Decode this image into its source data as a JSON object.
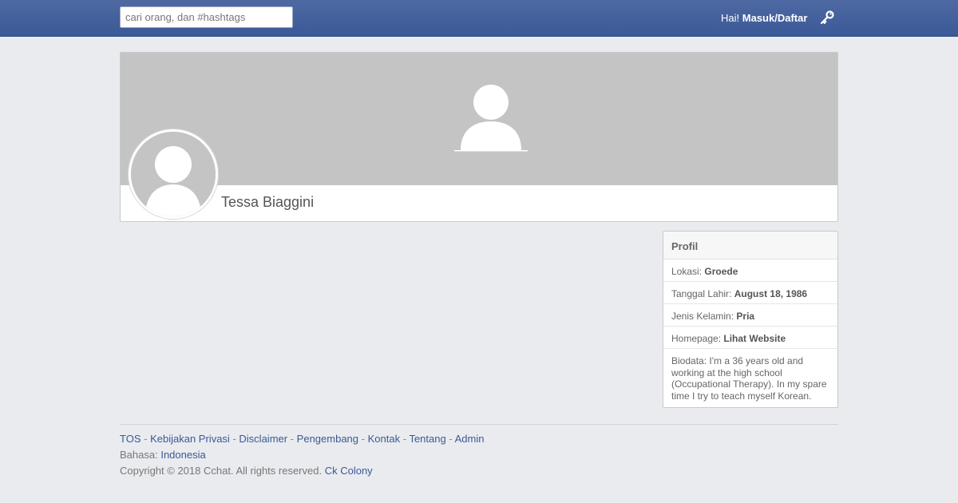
{
  "header": {
    "search_placeholder": "cari orang, dan #hashtags",
    "greeting": "Hai!",
    "login_label": "Masuk/Daftar"
  },
  "profile": {
    "name": "Tessa Biaggini"
  },
  "panel": {
    "title": "Profil",
    "location_label": "Lokasi:",
    "location_value": "Groede",
    "birth_label": "Tanggal Lahir:",
    "birth_value": "August 18, 1986",
    "gender_label": "Jenis Kelamin:",
    "gender_value": "Pria",
    "homepage_label": "Homepage:",
    "homepage_value": "Lihat Website",
    "bio_label": "Biodata:",
    "bio_value": "I'm a 36 years old and working at the high school (Occupational Therapy). In my spare time I try to teach myself Korean."
  },
  "footer": {
    "links": [
      "TOS",
      "Kebijakan Privasi",
      "Disclaimer",
      "Pengembang",
      "Kontak",
      "Tentang",
      "Admin"
    ],
    "separator": "-",
    "language_label": "Bahasa:",
    "language_value": "Indonesia",
    "copyright": "Copyright © 2018 Cchat. All rights reserved.",
    "credit": "Ck Colony"
  },
  "colors": {
    "topbar": "#3b5998",
    "link": "#3b5998",
    "cover": "#c4c4c4",
    "background": "#e9ebee"
  }
}
